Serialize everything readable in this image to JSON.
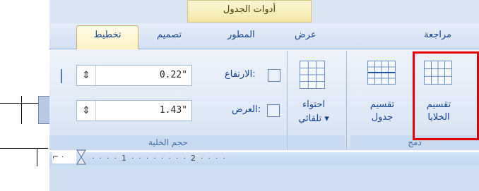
{
  "contextual_tab_group": "أدوات الجدول",
  "tabs": {
    "review": "مراجعة",
    "view": "عرض",
    "developer": "المطور",
    "design": "تصميم",
    "layout": "تخطيط"
  },
  "groups": {
    "merge": {
      "label": "دمج",
      "split_cells": [
        "تقسيم",
        "الخلايا"
      ],
      "split_table": [
        "تقسيم",
        "جدول"
      ]
    },
    "autofit": {
      "label_line1": "احتواء",
      "label_line2": "تلقائي ▾"
    },
    "cell_size": {
      "label": "حجم الخلية",
      "height_label": "الارتفاع:",
      "height_value": "0.22\"",
      "width_label": "العرض:",
      "width_value": "1.43\""
    }
  },
  "ruler": {
    "text": "·  ·  ·  ·  1  ·  ·  ·  ·  ·  ·  ·  ·  2  ·  ·  ·  ·"
  },
  "colors": {
    "highlight": "#e00000",
    "accent": "#15428b"
  },
  "icons": [
    "table-grid-icon",
    "split-cells-icon",
    "split-table-icon",
    "autofit-icon",
    "row-height-icon",
    "column-width-icon",
    "spin-arrows-icon",
    "hourglass-indent-icon"
  ]
}
